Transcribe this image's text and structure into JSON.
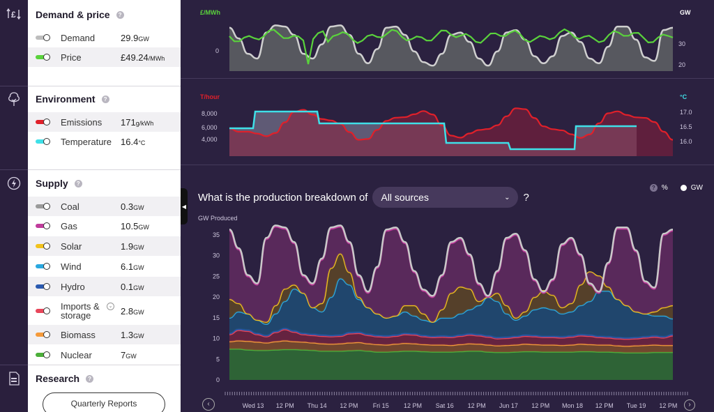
{
  "sections": {
    "demand_price": {
      "title": "Demand & price",
      "help": "?",
      "rows": [
        {
          "label": "Demand",
          "value": "29.9",
          "unit": "GW",
          "color": "#bdbdbd"
        },
        {
          "label": "Price",
          "value": "£49.24",
          "unit": "/MWh",
          "color": "#5ad23c"
        }
      ]
    },
    "environment": {
      "title": "Environment",
      "help": "?",
      "rows": [
        {
          "label": "Emissions",
          "value": "171",
          "unit": "g/kWh",
          "color": "#e0202a"
        },
        {
          "label": "Temperature",
          "value": "16.4",
          "unit": "°C",
          "color": "#3fe0e8"
        }
      ]
    },
    "supply": {
      "title": "Supply",
      "help": "?",
      "rows": [
        {
          "label": "Coal",
          "value": "0.3",
          "unit": "GW",
          "color": "#9a9a9a"
        },
        {
          "label": "Gas",
          "value": "10.5",
          "unit": "GW",
          "color": "#c03c9c"
        },
        {
          "label": "Solar",
          "value": "1.9",
          "unit": "GW",
          "color": "#f2c21c"
        },
        {
          "label": "Wind",
          "value": "6.1",
          "unit": "GW",
          "color": "#2aa8e0"
        },
        {
          "label": "Hydro",
          "value": "0.1",
          "unit": "GW",
          "color": "#2a5ab0"
        },
        {
          "label": "Imports &",
          "label2": "storage",
          "value": "2.8",
          "unit": "GW",
          "color": "#e8465a"
        },
        {
          "label": "Biomass",
          "value": "1.3",
          "unit": "GW",
          "color": "#f59a3a"
        },
        {
          "label": "Nuclear",
          "value": "7",
          "unit": "GW",
          "color": "#4caf3a"
        }
      ]
    },
    "research": {
      "title": "Research",
      "help": "?",
      "button": "Quarterly Reports"
    }
  },
  "rail_icons": [
    "pound-arrows-icon",
    "tree-icon",
    "lightning-icon",
    "document-icon"
  ],
  "chart_top": {
    "left_unit": "£/MWh",
    "right_unit": "GW",
    "left_ticks": [
      "0"
    ],
    "right_ticks": [
      "30",
      "20"
    ]
  },
  "chart_mid": {
    "left_unit": "T/hour",
    "right_unit": "°C",
    "left_ticks": [
      "8,000",
      "6,000",
      "4,000"
    ],
    "right_ticks": [
      "17.0",
      "16.5",
      "16.0"
    ]
  },
  "question": {
    "prefix": "What is the production breakdown of",
    "selected": "All sources",
    "suffix": "?"
  },
  "mode": {
    "help": "?",
    "percent": "%",
    "gw": "GW"
  },
  "chart_data": {
    "type": "area",
    "ylabel": "GW Produced",
    "ylim": [
      0,
      37
    ],
    "y_ticks": [
      "35",
      "30",
      "25",
      "20",
      "15",
      "10",
      "5",
      "0"
    ],
    "x_ticks": [
      "Wed 13",
      "12 PM",
      "Thu 14",
      "12 PM",
      "Fri 15",
      "12 PM",
      "Sat 16",
      "12 PM",
      "Jun 17",
      "12 PM",
      "Mon 18",
      "12 PM",
      "Tue 19",
      "12 PM"
    ],
    "series": [
      {
        "name": "Nuclear",
        "color": "#4caf3a",
        "top": [
          7.5,
          7.5,
          7.3,
          7.2,
          7.2,
          7.3,
          7.4,
          7.4,
          7.3,
          7.2,
          7.0,
          7.0,
          7.0,
          7.1,
          7.2,
          7.0,
          6.8,
          6.8,
          6.9,
          7.0,
          7.0,
          6.9,
          6.8,
          6.8,
          6.8,
          6.9,
          7.0,
          7.0,
          6.8,
          6.7,
          6.7,
          6.8,
          6.9,
          6.9,
          6.8,
          6.8,
          6.8,
          6.8,
          6.9,
          6.9,
          6.8,
          6.8,
          6.7,
          6.6,
          6.6,
          6.6,
          6.7,
          6.7,
          6.7
        ]
      },
      {
        "name": "Biomass",
        "color": "#f59a3a",
        "top": [
          9.3,
          9.5,
          9.4,
          9.2,
          9.0,
          9.3,
          9.5,
          9.3,
          9.2,
          9.0,
          8.8,
          8.7,
          8.8,
          9.0,
          9.1,
          8.8,
          8.6,
          8.5,
          8.7,
          8.9,
          8.8,
          8.6,
          8.5,
          8.5,
          8.4,
          8.6,
          8.8,
          8.7,
          8.5,
          8.3,
          8.4,
          8.5,
          8.7,
          8.6,
          8.5,
          8.5,
          8.4,
          8.5,
          8.7,
          8.6,
          8.5,
          8.5,
          8.3,
          8.2,
          8.3,
          8.4,
          8.5,
          8.4,
          8.4
        ]
      },
      {
        "name": "Imports & storage",
        "color": "#e8465a",
        "top": [
          11.0,
          12.0,
          11.8,
          11.0,
          10.5,
          11.5,
          12.2,
          11.6,
          11.0,
          10.8,
          10.6,
          10.5,
          10.6,
          11.2,
          11.3,
          10.8,
          10.5,
          10.4,
          10.6,
          11.0,
          10.9,
          10.5,
          10.3,
          10.4,
          10.3,
          10.6,
          10.9,
          10.7,
          10.4,
          10.0,
          10.1,
          10.3,
          10.6,
          10.5,
          10.3,
          10.3,
          10.2,
          10.4,
          10.7,
          10.6,
          10.3,
          10.2,
          10.0,
          9.9,
          10.0,
          10.2,
          10.4,
          10.2,
          10.7
        ]
      },
      {
        "name": "Hydro",
        "color": "#2a5ab0",
        "top": [
          11.3,
          12.3,
          12.1,
          11.3,
          10.8,
          11.8,
          12.5,
          11.9,
          11.3,
          11.1,
          10.9,
          10.8,
          10.9,
          11.5,
          11.6,
          11.1,
          10.8,
          10.7,
          10.9,
          11.3,
          11.2,
          10.8,
          10.6,
          10.7,
          10.6,
          10.9,
          11.2,
          11.0,
          10.7,
          10.3,
          10.4,
          10.6,
          10.9,
          10.8,
          10.6,
          10.6,
          10.5,
          10.7,
          11.0,
          10.9,
          10.6,
          10.5,
          10.3,
          10.2,
          10.3,
          10.5,
          10.7,
          10.5,
          11.0
        ]
      },
      {
        "name": "Wind",
        "color": "#2aa8e0",
        "top": [
          15.0,
          16.5,
          16.0,
          14.5,
          13.5,
          16.0,
          19.0,
          22.0,
          21.0,
          17.5,
          16.5,
          20.0,
          24.5,
          23.0,
          19.5,
          17.5,
          16.0,
          15.0,
          15.5,
          16.5,
          15.5,
          14.5,
          14.0,
          15.0,
          15.0,
          16.0,
          17.0,
          18.0,
          20.0,
          19.0,
          16.0,
          14.5,
          15.5,
          17.0,
          17.5,
          17.0,
          16.0,
          16.5,
          18.0,
          19.0,
          21.5,
          21.5,
          19.5,
          18.0,
          16.5,
          16.0,
          15.5,
          15.5,
          14.8
        ]
      },
      {
        "name": "Solar",
        "color": "#f2c21c",
        "top": [
          19.5,
          18.5,
          16.0,
          14.5,
          14.0,
          18.0,
          22.0,
          23.0,
          21.0,
          17.5,
          18.5,
          27.0,
          30.5,
          26.0,
          20.0,
          17.5,
          16.0,
          15.0,
          15.5,
          18.0,
          18.0,
          16.0,
          14.0,
          17.0,
          21.0,
          22.5,
          22.0,
          19.0,
          20.0,
          21.0,
          18.0,
          15.0,
          16.5,
          20.0,
          21.5,
          20.5,
          17.5,
          18.5,
          23.0,
          26.0,
          25.0,
          22.5,
          19.5,
          18.0,
          16.5,
          16.0,
          16.5,
          17.5,
          18.0
        ]
      },
      {
        "name": "Gas",
        "color": "#c03c9c",
        "top": [
          36.0,
          31.5,
          25.0,
          23.0,
          34.0,
          37.0,
          36.5,
          33.0,
          25.0,
          23.0,
          29.0,
          36.5,
          37.0,
          33.0,
          25.0,
          21.0,
          27.0,
          36.0,
          36.5,
          33.0,
          26.0,
          21.5,
          20.0,
          25.0,
          33.0,
          34.0,
          30.0,
          23.0,
          20.0,
          26.0,
          34.0,
          35.0,
          31.0,
          24.0,
          21.0,
          24.0,
          32.5,
          34.0,
          30.0,
          23.0,
          21.0,
          28.0,
          36.5,
          36.5,
          31.0,
          23.5,
          22.0,
          35.0,
          36.0
        ]
      },
      {
        "name": "Demand",
        "color": "#c9c9c9",
        "top": [
          36.3,
          31.8,
          25.3,
          23.3,
          34.3,
          37.3,
          36.8,
          33.3,
          25.3,
          23.3,
          29.3,
          36.8,
          37.3,
          33.3,
          25.3,
          21.3,
          27.3,
          36.3,
          36.8,
          33.3,
          26.3,
          21.8,
          20.3,
          25.3,
          33.3,
          34.3,
          30.3,
          23.3,
          20.3,
          26.3,
          34.3,
          35.3,
          31.3,
          24.3,
          21.3,
          24.3,
          32.8,
          34.3,
          30.3,
          23.3,
          21.3,
          28.3,
          36.8,
          36.8,
          31.3,
          23.8,
          22.3,
          35.3,
          36.3
        ]
      }
    ]
  }
}
